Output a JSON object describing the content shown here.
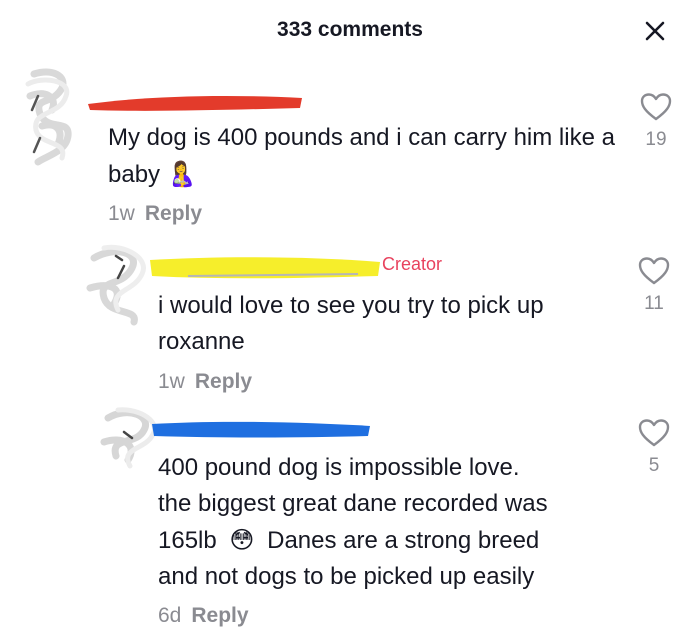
{
  "header": {
    "title": "333 comments",
    "close_icon": "close-icon"
  },
  "comments": [
    {
      "text": "My dog is 400 pounds and i can carry him like a baby",
      "emoji": "🤱",
      "age": "1w",
      "reply_label": "Reply",
      "likes": "19",
      "redaction_color": "#e33b2b"
    },
    {
      "creator_tag": "Creator",
      "text": "i would love to see you try to pick up roxanne",
      "age": "1w",
      "reply_label": "Reply",
      "likes": "11",
      "redaction_color": "#f6ee2b"
    },
    {
      "text_line1": "400 pound dog is impossible love.",
      "text_line2": "the biggest great dane recorded was",
      "text_line3_a": "165lb",
      "emoji": "😳",
      "text_line3_b": "Danes are a strong breed",
      "text_line4": "and not dogs to be picked up easily",
      "age": "6d",
      "reply_label": "Reply",
      "likes": "5",
      "redaction_color": "#1f6fe0"
    }
  ]
}
